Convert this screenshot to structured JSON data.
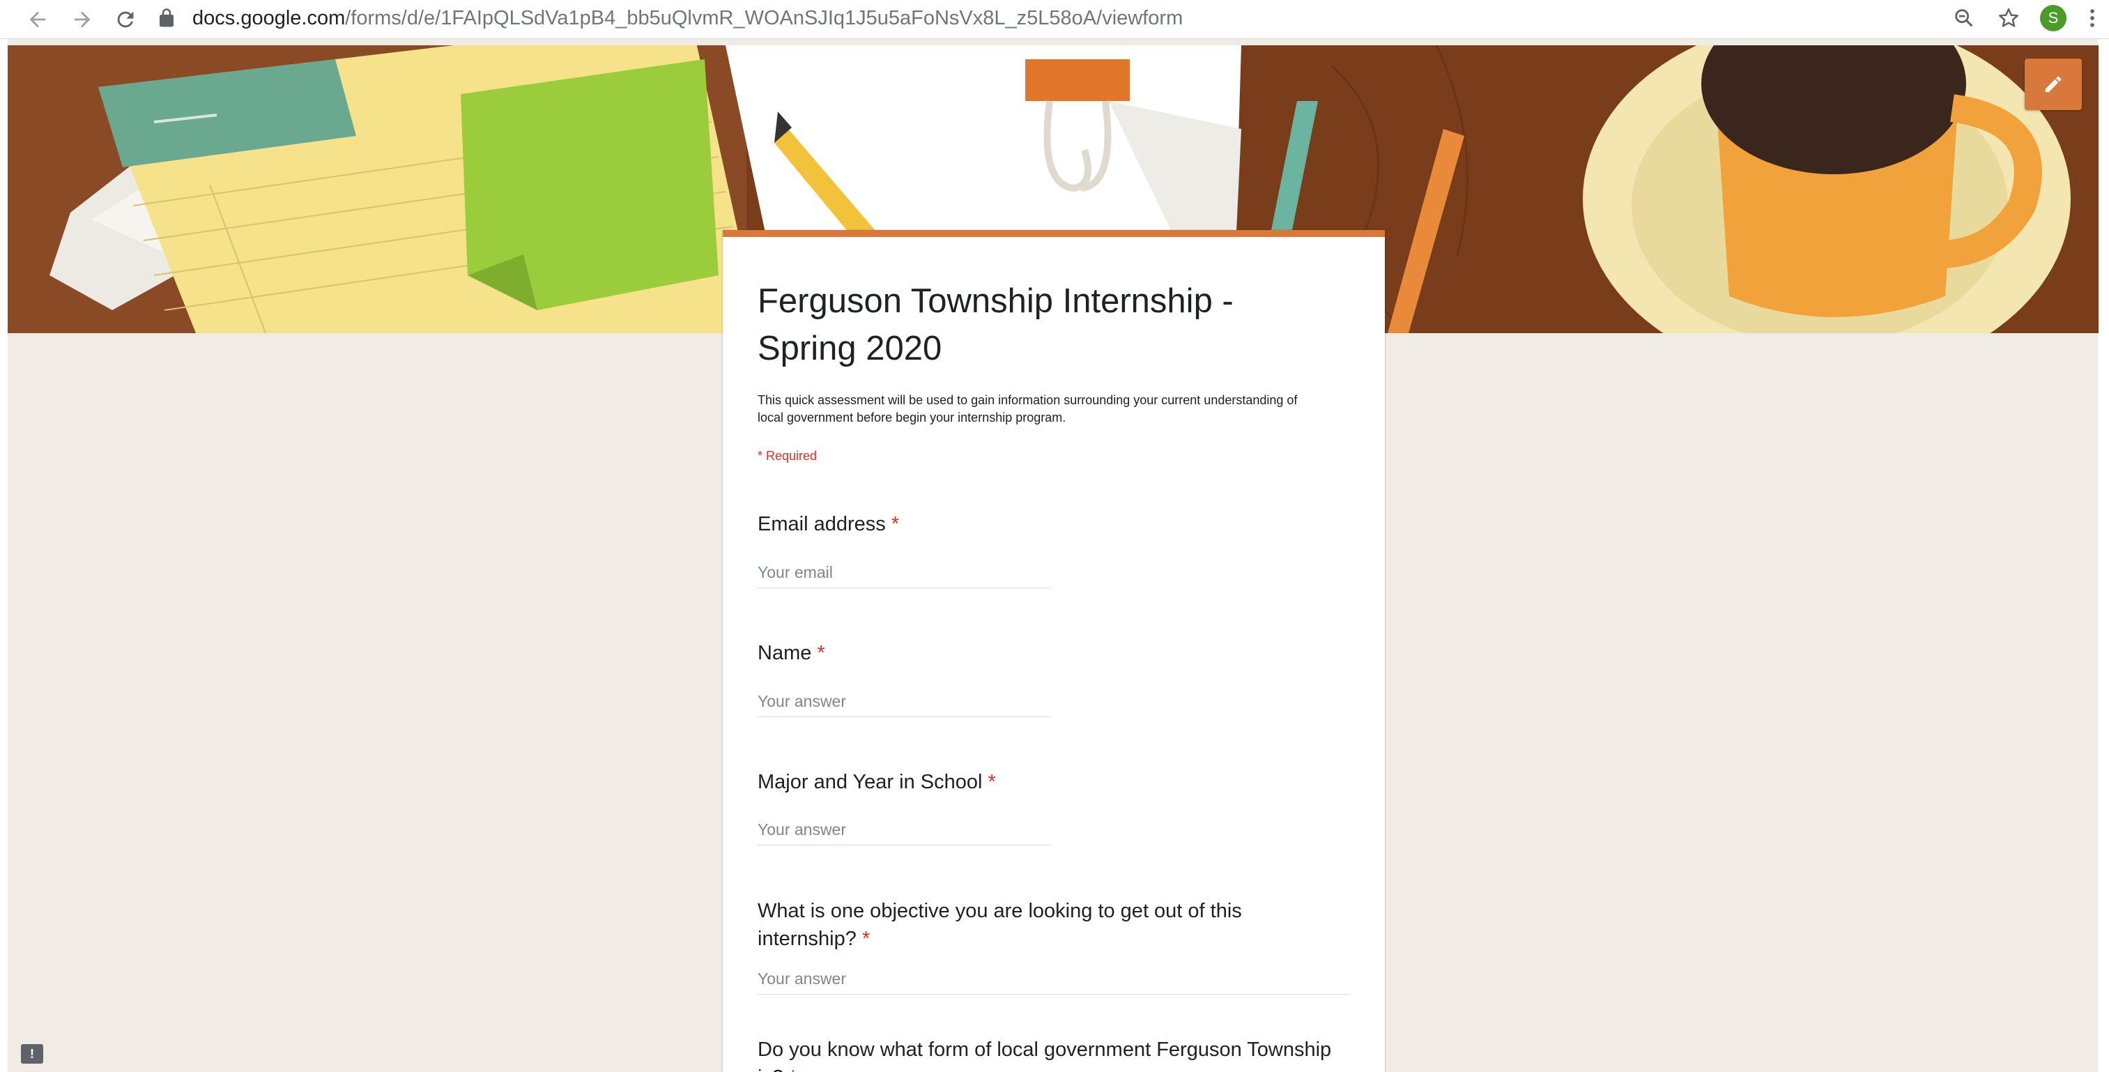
{
  "browser": {
    "url_host": "docs.google.com",
    "url_path": "/forms/d/e/1FAIpQLSdVa1pB4_bb5uQlvmR_WOAnSJIq1J5u5aFoNsVx8L_z5L58oA/viewform",
    "avatar_letter": "S",
    "icons": [
      "back-arrow-icon",
      "forward-arrow-icon",
      "reload-icon",
      "lock-icon",
      "zoom-out-icon",
      "star-icon",
      "more-vert-icon"
    ]
  },
  "theme": {
    "accent": "#d8783a",
    "page_bg": "#f1ebe6",
    "required_color": "#d93025"
  },
  "form": {
    "title_line1": "Ferguson Township Internship -",
    "title_line2": "Spring 2020",
    "description_line1": "This quick assessment will be used to gain information surrounding your current understanding of",
    "description_line2": "local government before begin your internship program.",
    "required_note": "* Required",
    "questions": [
      {
        "label": "Email address",
        "required_mark": "*",
        "placeholder": "Your email"
      },
      {
        "label": "Name",
        "required_mark": "*",
        "placeholder": "Your answer"
      },
      {
        "label": "Major and Year in School",
        "required_mark": "*",
        "placeholder": "Your answer"
      },
      {
        "label_line1": "What is one objective you are looking to get out of this",
        "label_line2": "internship?",
        "required_mark": "*",
        "placeholder": "Your answer"
      },
      {
        "label_line1": "Do you know what form of local government Ferguson Township",
        "label_line2": "is?",
        "required_mark": "*"
      }
    ]
  },
  "edit_icon": "pencil-icon",
  "feedback_icon": "feedback-icon",
  "feedback_glyph": "!"
}
